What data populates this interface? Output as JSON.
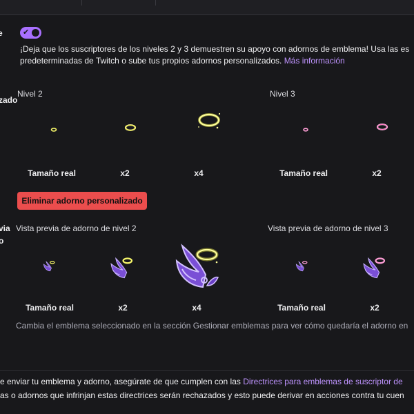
{
  "toggle": {
    "label_fragment": "e",
    "checked": true
  },
  "description": {
    "line1": "¡Deja que los suscriptores de los niveles 2 y 3 demuestren su apoyo con adornos de emblema! Usa las es",
    "line2_text": "predeterminadas de Twitch o sube tus propios adornos personalizados.",
    "line2_link": "Más información"
  },
  "custom_section": {
    "label_fragment": "zado"
  },
  "levels": {
    "tier2": {
      "title": "Nivel 2"
    },
    "tier3": {
      "title": "Nivel 3"
    }
  },
  "size_captions": {
    "actual": "Tamaño real",
    "x2": "x2",
    "x4": "x4"
  },
  "remove_button_label": "Eliminar adorno personalizado",
  "preview_section": {
    "label_fragment_1": "via",
    "label_fragment_2": "o",
    "tier2_title": "Vista previa de adorno de nivel 2",
    "tier3_title": "Vista previa de adorno de nivel 3"
  },
  "hint_text": "Cambia el emblema seleccionado en la sección Gestionar emblemas para ver cómo quedaría el adorno en",
  "footer": {
    "line1_text": "e enviar tu emblema y adorno, asegúrate de que cumplen con las",
    "line1_link": "Directrices para emblemas de suscriptor de",
    "line2_text": "as o adornos que infrinjan estas directrices serán rechazados y esto puede derivar en acciones contra tu cuen"
  },
  "colors": {
    "accent": "#a970ff",
    "link": "#bf94ff",
    "danger": "#eb4d4d",
    "halo_tier2": "#f7f76a",
    "halo_tier3": "#ff9ed6",
    "wing_purple": "#7a4fd6"
  },
  "icons": {
    "toggle": "checkmark-icon",
    "tier2_adornment": "golden-halo-icon",
    "tier3_adornment": "pink-halo-icon",
    "badge_preview": "purple-wing-badge-icon"
  }
}
